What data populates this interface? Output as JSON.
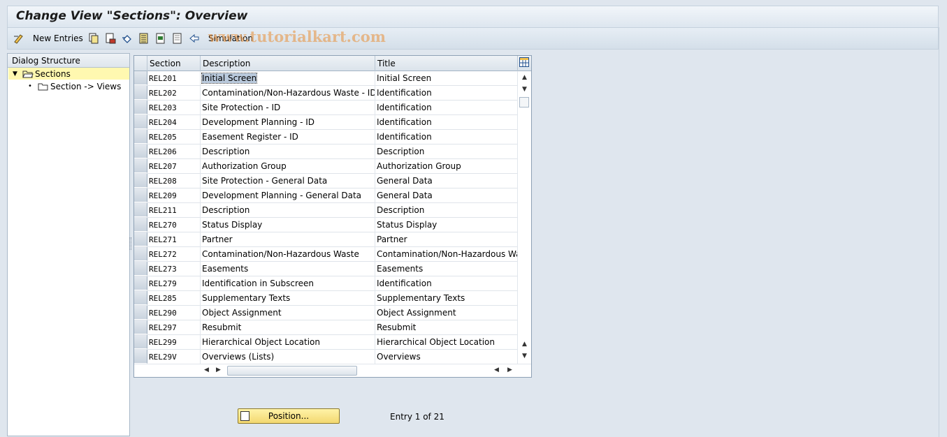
{
  "window": {
    "title": "Change View \"Sections\": Overview"
  },
  "toolbar": {
    "new_entries_label": "New Entries",
    "simulation_label": "Simulation",
    "watermark": "www.tutorialkart.com"
  },
  "dialog_structure": {
    "header": "Dialog Structure",
    "items": [
      {
        "label": "Sections",
        "selected": true,
        "expanded": true
      },
      {
        "label": "Section -> Views",
        "selected": false
      }
    ]
  },
  "table": {
    "columns": [
      "Section",
      "Description",
      "Title"
    ],
    "rows": [
      {
        "section": "REL201",
        "description": "Initial Screen",
        "title": "Initial Screen"
      },
      {
        "section": "REL202",
        "description": "Contamination/Non-Hazardous Waste - ID",
        "title": "Identification"
      },
      {
        "section": "REL203",
        "description": "Site Protection - ID",
        "title": "Identification"
      },
      {
        "section": "REL204",
        "description": "Development Planning - ID",
        "title": "Identification"
      },
      {
        "section": "REL205",
        "description": "Easement Register - ID",
        "title": "Identification"
      },
      {
        "section": "REL206",
        "description": "Description",
        "title": "Description"
      },
      {
        "section": "REL207",
        "description": "Authorization Group",
        "title": "Authorization Group"
      },
      {
        "section": "REL208",
        "description": "Site Protection - General Data",
        "title": "General Data"
      },
      {
        "section": "REL209",
        "description": "Development Planning - General Data",
        "title": "General Data"
      },
      {
        "section": "REL211",
        "description": "Description",
        "title": "Description"
      },
      {
        "section": "REL270",
        "description": "Status Display",
        "title": "Status Display"
      },
      {
        "section": "REL271",
        "description": "Partner",
        "title": "Partner"
      },
      {
        "section": "REL272",
        "description": "Contamination/Non-Hazardous Waste",
        "title": "Contamination/Non-Hazardous Waste"
      },
      {
        "section": "REL273",
        "description": "Easements",
        "title": "Easements"
      },
      {
        "section": "REL279",
        "description": "Identification in Subscreen",
        "title": "Identification"
      },
      {
        "section": "REL285",
        "description": "Supplementary Texts",
        "title": "Supplementary Texts"
      },
      {
        "section": "REL290",
        "description": "Object Assignment",
        "title": "Object Assignment"
      },
      {
        "section": "REL297",
        "description": "Resubmit",
        "title": "Resubmit"
      },
      {
        "section": "REL299",
        "description": "Hierarchical Object Location",
        "title": "Hierarchical Object Location"
      },
      {
        "section": "REL29V",
        "description": "Overviews (Lists)",
        "title": "Overviews"
      }
    ]
  },
  "footer": {
    "position_button_label": "Position...",
    "entry_info": "Entry 1 of 21"
  },
  "colors": {
    "background": "#dfe6ee",
    "tree_selection": "#fff8b0",
    "position_button": "#f6de80"
  }
}
